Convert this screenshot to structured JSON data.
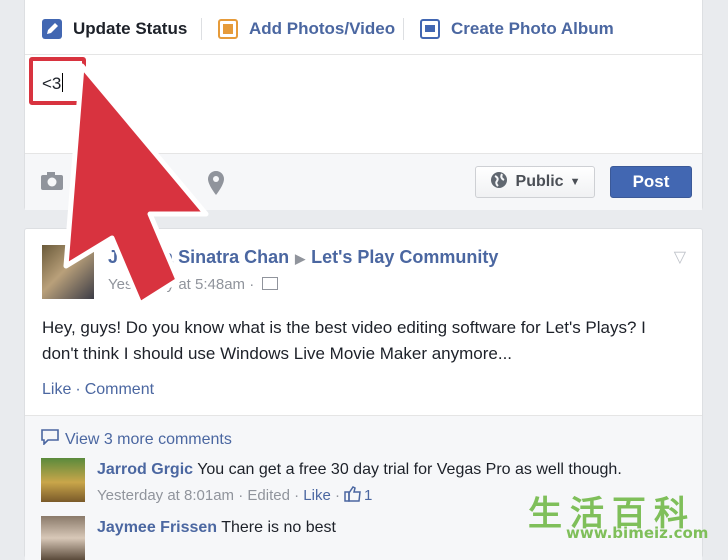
{
  "composer": {
    "tabs": [
      {
        "label": "Update Status",
        "icon": "pencil-icon"
      },
      {
        "label": "Add Photos/Video",
        "icon": "photo-icon"
      },
      {
        "label": "Create Photo Album",
        "icon": "album-icon"
      }
    ],
    "status_value": "<3",
    "audience_label": "Public",
    "post_label": "Post",
    "footer_icons": [
      "camera-icon",
      "smiley-icon",
      "location-pin-icon"
    ]
  },
  "post": {
    "author": "Jessica Sinatra Chan",
    "group": "Let's Play Community",
    "timestamp": "Yesterday at 5:48am",
    "body": "Hey, guys! Do you know what is the best video editing software for Let's Plays? I don't think I should use Windows Live Movie Maker anymore...",
    "like_label": "Like",
    "comment_label": "Comment",
    "view_more": "View 3 more comments",
    "comments": [
      {
        "name": "Jarrod Grgic",
        "text": "You can get a free 30 day trial for Vegas Pro as well though.",
        "time": "Yesterday at 8:01am",
        "edited": "Edited",
        "like": "Like",
        "likes_count": "1"
      },
      {
        "name": "Jaymee Frissen",
        "text": "There is no best"
      }
    ]
  },
  "watermark": {
    "chars": "生活百科",
    "url": "www.bimeiz.com"
  },
  "colors": {
    "accent": "#4267b2",
    "link": "#4b67a1",
    "highlight": "#d8333f",
    "watermark": "#7fbf5a"
  }
}
